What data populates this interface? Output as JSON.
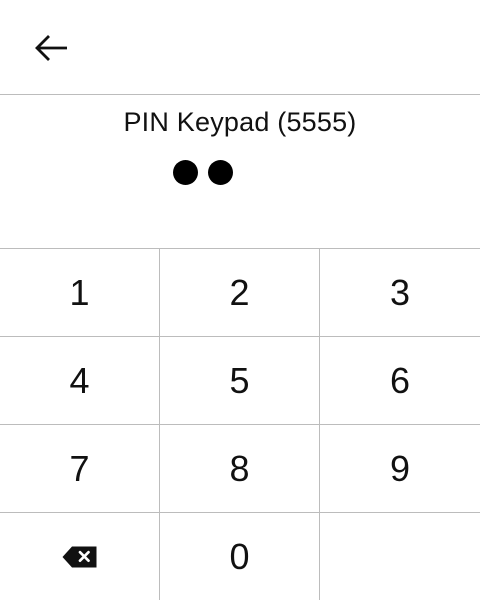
{
  "header": {
    "back_icon": "arrow-left-icon"
  },
  "title": "PIN Keypad (5555)",
  "pin": {
    "entered_count": 2
  },
  "keypad": {
    "keys": [
      "1",
      "2",
      "3",
      "4",
      "5",
      "6",
      "7",
      "8",
      "9",
      "",
      "0",
      ""
    ],
    "backspace_icon": "backspace-icon"
  }
}
